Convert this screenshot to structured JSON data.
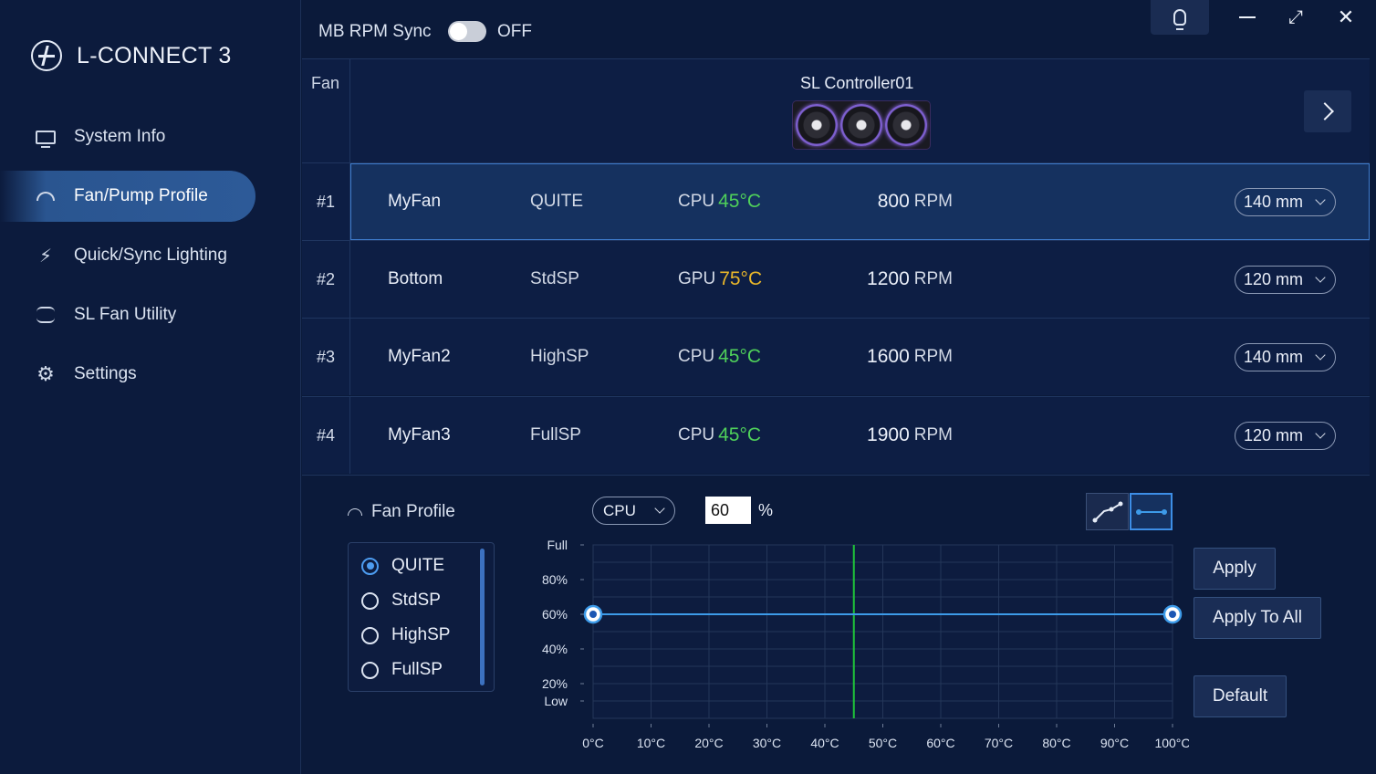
{
  "app": {
    "title": "L-CONNECT 3"
  },
  "sidebar": {
    "items": [
      {
        "label": "System Info",
        "icon": "monitor-icon"
      },
      {
        "label": "Fan/Pump Profile",
        "icon": "gauge-icon",
        "active": true
      },
      {
        "label": "Quick/Sync Lighting",
        "icon": "bolt-icon"
      },
      {
        "label": "SL Fan Utility",
        "icon": "sl-fan-icon"
      },
      {
        "label": "Settings",
        "icon": "gear-icon"
      }
    ]
  },
  "topbar": {
    "sync_label": "MB RPM Sync",
    "sync_state": "OFF"
  },
  "table": {
    "fan_header": "Fan",
    "controller": "SL Controller01",
    "rows": [
      {
        "num": "#1",
        "name": "MyFan",
        "profile": "QUITE",
        "source": "CPU",
        "temp": "45°C",
        "temp_color": "#4fd05a",
        "rpm": "800",
        "rpm_unit": "RPM",
        "size": "140 mm"
      },
      {
        "num": "#2",
        "name": "Bottom",
        "profile": "StdSP",
        "source": "GPU",
        "temp": "75°C",
        "temp_color": "#e8b62a",
        "rpm": "1200",
        "rpm_unit": "RPM",
        "size": "120 mm"
      },
      {
        "num": "#3",
        "name": "MyFan2",
        "profile": "HighSP",
        "source": "CPU",
        "temp": "45°C",
        "temp_color": "#4fd05a",
        "rpm": "1600",
        "rpm_unit": "RPM",
        "size": "140 mm"
      },
      {
        "num": "#4",
        "name": "MyFan3",
        "profile": "FullSP",
        "source": "CPU",
        "temp": "45°C",
        "temp_color": "#4fd05a",
        "rpm": "1900",
        "rpm_unit": "RPM",
        "size": "120 mm"
      }
    ]
  },
  "profile_panel": {
    "title": "Fan Profile",
    "options": [
      "QUITE",
      "StdSP",
      "HighSP",
      "FullSP"
    ],
    "selected": "QUITE",
    "source": "CPU",
    "percent": "60",
    "percent_unit": "%",
    "apply": "Apply",
    "apply_all": "Apply To All",
    "default": "Default"
  },
  "chart_data": {
    "type": "line",
    "x_ticks": [
      "0°C",
      "10°C",
      "20°C",
      "30°C",
      "40°C",
      "50°C",
      "60°C",
      "70°C",
      "80°C",
      "90°C",
      "100°C"
    ],
    "y_ticks": [
      "Full",
      "80%",
      "60%",
      "40%",
      "20%",
      "Low"
    ],
    "y_tick_values": [
      100,
      80,
      60,
      40,
      20,
      10
    ],
    "xlim": [
      0,
      100
    ],
    "ylim": [
      0,
      100
    ],
    "series": [
      {
        "values": [
          [
            0,
            60
          ],
          [
            100,
            60
          ]
        ],
        "color": "#3d9be9"
      }
    ],
    "current_temp": 45,
    "current_temp_color": "#1fc43a",
    "grid": true
  }
}
